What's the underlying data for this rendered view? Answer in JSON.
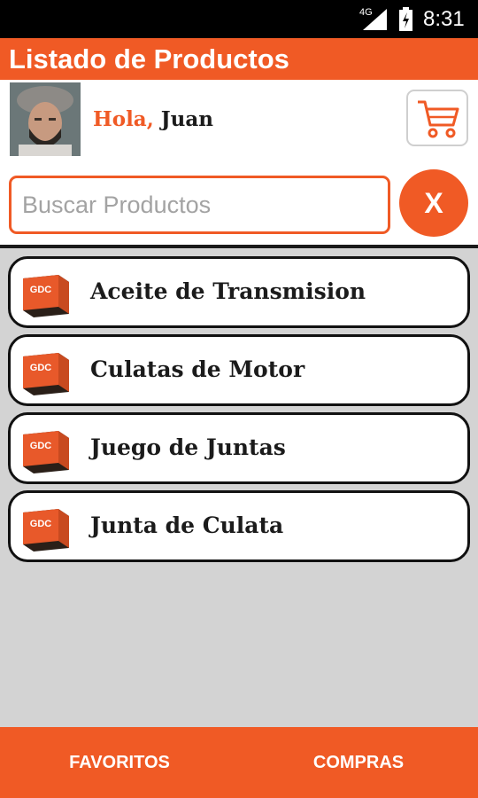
{
  "status_bar": {
    "network": "4G",
    "time": "8:31",
    "icons": [
      "signal-icon",
      "battery-icon"
    ]
  },
  "app_bar": {
    "title": "Listado de Productos"
  },
  "user": {
    "greeting": "Hola,",
    "name": "Juan",
    "avatar_icon": "avatar"
  },
  "cart": {
    "icon": "shopping-cart-icon"
  },
  "search": {
    "placeholder": "Buscar Productos",
    "value": "",
    "clear_label": "X"
  },
  "products": [
    {
      "label": "Aceite de Transmision",
      "thumb_text": "GDC"
    },
    {
      "label": "Culatas de Motor",
      "thumb_text": "GDC"
    },
    {
      "label": "Juego de Juntas",
      "thumb_text": "GDC"
    },
    {
      "label": "Junta de Culata",
      "thumb_text": "GDC"
    }
  ],
  "bottom_nav": {
    "favoritos": "FAVORITOS",
    "compras": "COMPRAS"
  },
  "colors": {
    "accent": "#f05a25",
    "background": "#d3d3d3",
    "status_bar": "#000000"
  }
}
